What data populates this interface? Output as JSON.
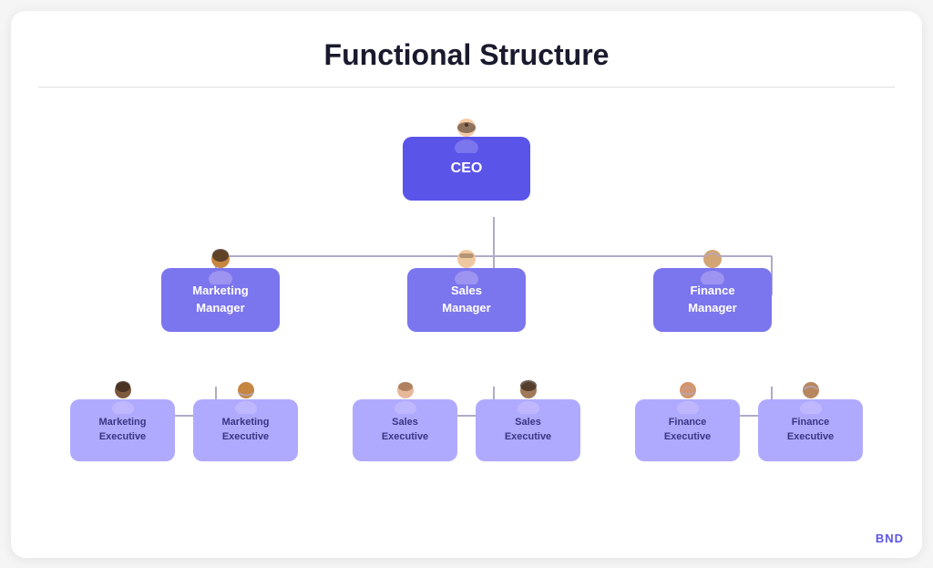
{
  "page": {
    "title": "Functional Structure",
    "watermark": "BND"
  },
  "nodes": {
    "ceo": {
      "label": "CEO",
      "level": "ceo"
    },
    "managers": [
      {
        "id": "marketing-manager",
        "label": "Marketing\nManager"
      },
      {
        "id": "sales-manager",
        "label": "Sales\nManager"
      },
      {
        "id": "finance-manager",
        "label": "Finance\nManager"
      }
    ],
    "executives": [
      {
        "id": "marketing-exec-1",
        "label": "Marketing\nExecutive",
        "parent": "marketing-manager"
      },
      {
        "id": "marketing-exec-2",
        "label": "Marketing\nExecutive",
        "parent": "marketing-manager"
      },
      {
        "id": "sales-exec-1",
        "label": "Sales\nExecutive",
        "parent": "sales-manager"
      },
      {
        "id": "sales-exec-2",
        "label": "Sales\nExecutive",
        "parent": "sales-manager"
      },
      {
        "id": "finance-exec-1",
        "label": "Finance\nExecutive",
        "parent": "finance-manager"
      },
      {
        "id": "finance-exec-2",
        "label": "Finance\nExecutive",
        "parent": "finance-manager"
      }
    ]
  },
  "avatars": {
    "ceo": "female-light",
    "marketing-manager": "female-dark",
    "sales-manager": "male-light",
    "finance-manager": "male-blue",
    "marketing-exec-1": "male-dark",
    "marketing-exec-2": "male-beard",
    "sales-exec-1": "female-brown",
    "sales-exec-2": "female-dark2",
    "finance-exec-1": "male-beard2",
    "finance-exec-2": "male-blue2"
  }
}
